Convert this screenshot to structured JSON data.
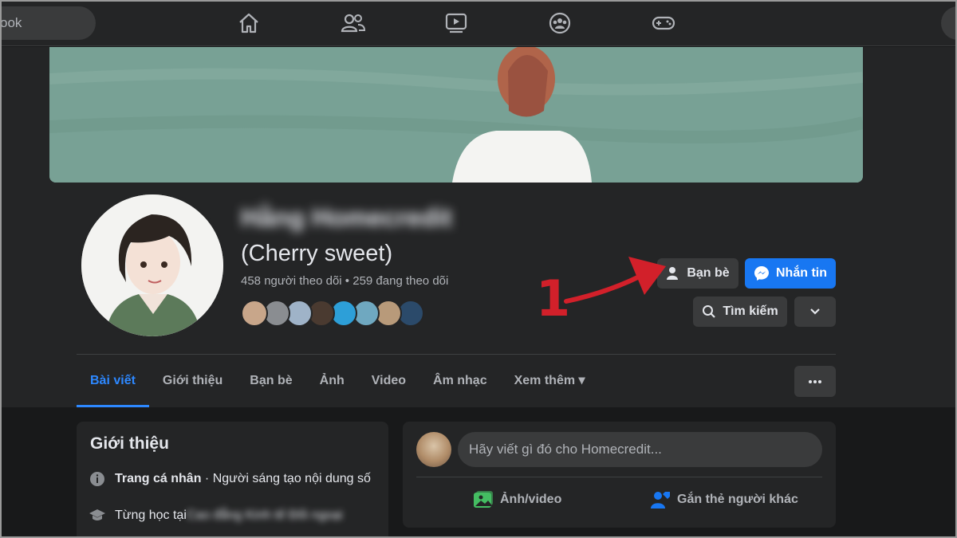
{
  "nav": {
    "search_text": "ook",
    "icons": [
      "home-icon",
      "friends-icon",
      "watch-icon",
      "groups-icon",
      "gaming-icon"
    ]
  },
  "profile": {
    "name": "Hằng Homecredit",
    "subname": "(Cherry sweet)",
    "followers": "458 người theo dõi • 259 đang theo dõi",
    "friend_avatar_colors": [
      "#c8a68a",
      "#8a8d91",
      "#9fb3c8",
      "#4a3a30",
      "#2d9fd8",
      "#6fa8c0",
      "#b89a7a",
      "#2b4a6a"
    ]
  },
  "actions": {
    "friends_label": "Bạn bè",
    "message_label": "Nhắn tin",
    "search_label": "Tìm kiếm"
  },
  "annotation": {
    "marker": "1"
  },
  "tabs": [
    {
      "label": "Bài viết",
      "active": true
    },
    {
      "label": "Giới thiệu"
    },
    {
      "label": "Bạn bè"
    },
    {
      "label": "Ảnh"
    },
    {
      "label": "Video"
    },
    {
      "label": "Âm nhạc"
    },
    {
      "label": "Xem thêm"
    }
  ],
  "intro": {
    "title": "Giới thiệu",
    "page_label": "Trang cá nhân",
    "page_desc": " · Người sáng tạo nội dung số",
    "studied_label": "Từng học tại",
    "studied_value": "Cao đẳng Kinh tế Đối ngoại"
  },
  "composer": {
    "placeholder": "Hãy viết gì đó cho Homecredit...",
    "photo_label": "Ảnh/video",
    "tag_label": "Gắn thẻ người khác"
  },
  "colors": {
    "accent": "#1877f2",
    "active_tab": "#2d88ff",
    "annotation_red": "#d2202a"
  }
}
